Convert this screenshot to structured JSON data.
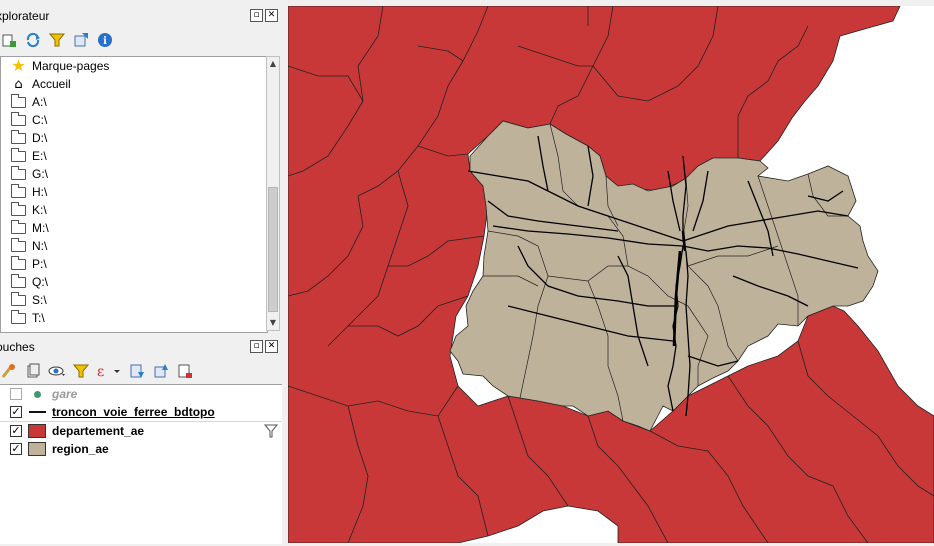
{
  "browser_panel": {
    "title": "xplorateur",
    "toolbar_icons": [
      "add-layer-icon",
      "refresh-icon",
      "filter-icon",
      "collapse-all-icon",
      "info-icon"
    ],
    "items": [
      {
        "label": "Marque-pages",
        "icon": "star-icon"
      },
      {
        "label": "Accueil",
        "icon": "home-icon"
      },
      {
        "label": "A:\\",
        "icon": "folder-icon"
      },
      {
        "label": "C:\\",
        "icon": "folder-icon"
      },
      {
        "label": "D:\\",
        "icon": "folder-icon"
      },
      {
        "label": "E:\\",
        "icon": "folder-icon"
      },
      {
        "label": "G:\\",
        "icon": "folder-icon"
      },
      {
        "label": "H:\\",
        "icon": "folder-icon"
      },
      {
        "label": "K:\\",
        "icon": "folder-icon"
      },
      {
        "label": "M:\\",
        "icon": "folder-icon"
      },
      {
        "label": "N:\\",
        "icon": "folder-icon"
      },
      {
        "label": "P:\\",
        "icon": "folder-icon"
      },
      {
        "label": "Q:\\",
        "icon": "folder-icon"
      },
      {
        "label": "S:\\",
        "icon": "folder-icon"
      },
      {
        "label": "T:\\",
        "icon": "folder-icon"
      }
    ]
  },
  "layers_panel": {
    "title": "ouches",
    "toolbar_icons": [
      "style-icon",
      "add-group-icon",
      "visibility-icon",
      "filter-icon",
      "expression-icon",
      "expand-all-icon",
      "collapse-all-icon",
      "remove-layer-icon"
    ],
    "layers": [
      {
        "name": "gare",
        "checked": false,
        "symbol": "point",
        "color": "#3c9a6e"
      },
      {
        "name": "troncon_voie_ferree_bdtopo",
        "checked": true,
        "symbol": "line",
        "color": "#111111"
      },
      {
        "name": "departement_ae",
        "checked": true,
        "symbol": "fill",
        "color": "#c83838",
        "filtered": true
      },
      {
        "name": "region_ae",
        "checked": true,
        "symbol": "fill",
        "color": "#bfb29a"
      }
    ]
  },
  "map": {
    "departement_color": "#c83838",
    "region_color": "#bfb29a",
    "railway_color": "#000000",
    "border_color": "#222222"
  }
}
